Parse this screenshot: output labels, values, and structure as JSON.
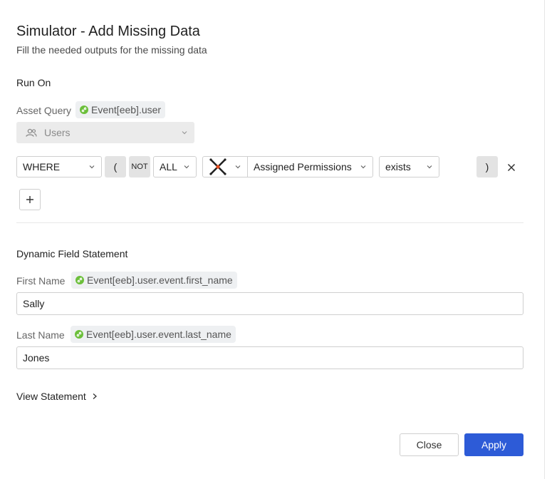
{
  "dialog": {
    "title": "Simulator - Add Missing Data",
    "subtitle": "Fill the needed outputs for the missing data"
  },
  "run_on": {
    "label": "Run On",
    "asset_query_label": "Asset Query",
    "asset_query_tag": "Event[eeb].user",
    "asset_select": "Users"
  },
  "filter": {
    "where": "WHERE",
    "open_paren": "(",
    "not": "NOT",
    "all": "ALL",
    "field": "Assigned Permissions",
    "operator": "exists",
    "close_paren": ")"
  },
  "dynamic": {
    "heading": "Dynamic Field Statement",
    "first_name_label": "First Name",
    "first_name_tag": "Event[eeb].user.event.first_name",
    "first_name_value": "Sally",
    "last_name_label": "Last Name",
    "last_name_tag": "Event[eeb].user.event.last_name",
    "last_name_value": "Jones",
    "view_statement": "View Statement"
  },
  "footer": {
    "close": "Close",
    "apply": "Apply"
  },
  "colors": {
    "primary": "#2d5bd7",
    "tag_green": "#6cbf3b",
    "disabled_bg": "#ebebeb"
  }
}
